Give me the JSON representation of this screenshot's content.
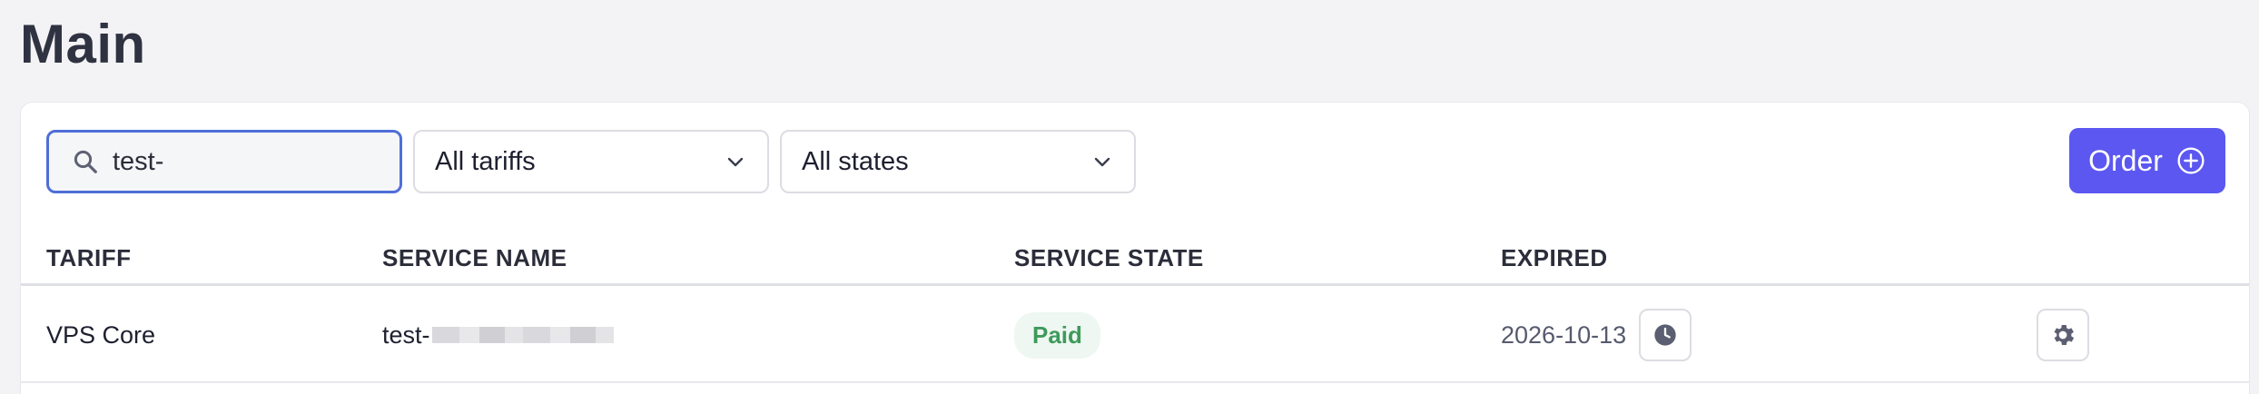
{
  "page": {
    "title": "Main"
  },
  "filters": {
    "search": {
      "value": "test-",
      "icon": "search-icon"
    },
    "tariff_select": {
      "selected": "All tariffs"
    },
    "state_select": {
      "selected": "All states"
    }
  },
  "toolbar": {
    "order_label": "Order",
    "order_icon": "plus-circle-icon",
    "accent": "#5b57f0"
  },
  "table": {
    "columns": [
      "TARIFF",
      "SERVICE NAME",
      "SERVICE STATE",
      "EXPIRED"
    ],
    "rows": [
      {
        "tariff": "VPS Core",
        "service_name": "test-",
        "service_state": "Paid",
        "expired": "2026-10-13"
      }
    ]
  },
  "colors": {
    "paid_badge_bg": "#eef7f1",
    "paid_badge_text": "#3f9a5c",
    "focus_border": "#4f6ed8"
  }
}
